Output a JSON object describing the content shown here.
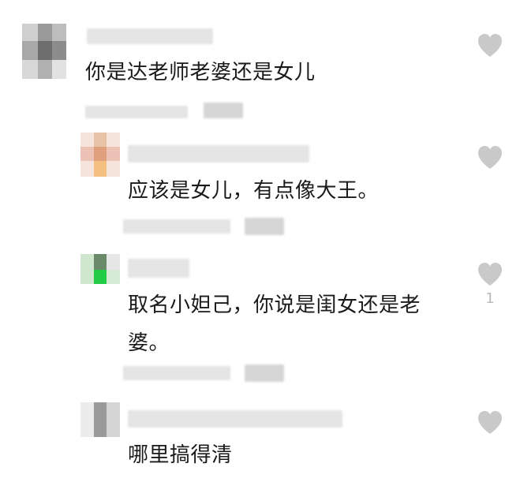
{
  "comments": [
    {
      "text": "你是达老师老婆还是女儿"
    },
    {
      "text": "应该是女儿，有点像大王。"
    },
    {
      "text_line1": "取名小妲己，你说是闺女还是老",
      "text_line2": "婆。",
      "like_count": "1"
    },
    {
      "text": "哪里搞得清"
    }
  ],
  "icons": {
    "like": "heart-icon"
  },
  "colors": {
    "heart": "#c9c9c9",
    "text": "#1a1a1a",
    "count": "#b8b8b8"
  }
}
